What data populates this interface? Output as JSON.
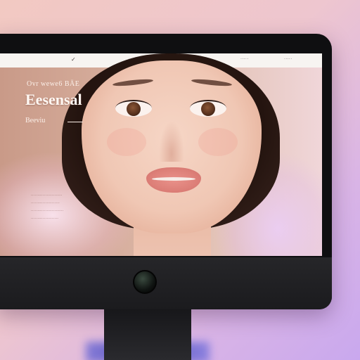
{
  "nav": {
    "mark": "✓",
    "link_1": "←→",
    "brand": "··· ····",
    "link_2": "·····",
    "link_3": "·····"
  },
  "hero": {
    "eyebrow": "Ovr wewe6 BÄE",
    "title": "Eesensal",
    "cta": "Beeviu",
    "captions": [
      "························",
      "······················",
      "·························",
      "·····················"
    ]
  },
  "colors": {
    "background_accent": "#d9b4e6",
    "skin_tone": "#f0c7b4",
    "lip_color": "#dd7f78",
    "bezel": "#0f0f11"
  }
}
